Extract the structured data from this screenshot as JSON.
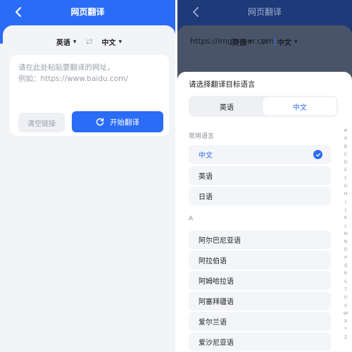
{
  "left": {
    "header": {
      "title": "网页翻译"
    },
    "source_lang": "英语",
    "target_lang": "中文",
    "input": {
      "placeholder": "请在此处粘贴要翻译的网址，\n例如：https://www.baidu.com/"
    },
    "clear_label": "清空链接",
    "translate_label": "开始翻译"
  },
  "right": {
    "header": {
      "title": "网页翻译"
    },
    "source_lang": "英语",
    "target_lang": "中文",
    "url_text": "https://imglarger.com",
    "sheet": {
      "title": "请选择翻译目标语言",
      "tabs": [
        {
          "label": "英语",
          "active": false
        },
        {
          "label": "中文",
          "active": true
        }
      ],
      "common_label": "常用语言",
      "common_languages": [
        "中文",
        "英语",
        "日语"
      ],
      "selected_language": "中文",
      "section_a_label": "A",
      "a_languages": [
        "阿尔巴尼亚语",
        "阿拉伯语",
        "阿姆哈拉语",
        "阿塞拜疆语",
        "爱尔兰语",
        "爱沙尼亚语"
      ],
      "alphabet_index": [
        "#",
        "A",
        "B",
        "C",
        "D",
        "E",
        "F",
        "G",
        "H",
        "I",
        "J",
        "K",
        "L",
        "M",
        "N",
        "O",
        "P",
        "Q",
        "R",
        "S",
        "T",
        "U",
        "V",
        "W",
        "X",
        "Y",
        "Z"
      ]
    }
  },
  "colors": {
    "accent": "#2b6cf6",
    "page_bg": "#f2f4f7",
    "overlay": "#2d3a52"
  }
}
